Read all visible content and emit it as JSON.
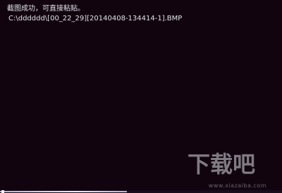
{
  "console": {
    "lines": [
      "截图成功，可直接粘贴。",
      "C:\\dddddd\\[00_22_29][20140408-134414-1].BMP"
    ]
  },
  "watermark": {
    "logo_text": "下载吧",
    "site": "www.xiazaiba.com"
  },
  "progress": {
    "fraction": 0.45
  }
}
